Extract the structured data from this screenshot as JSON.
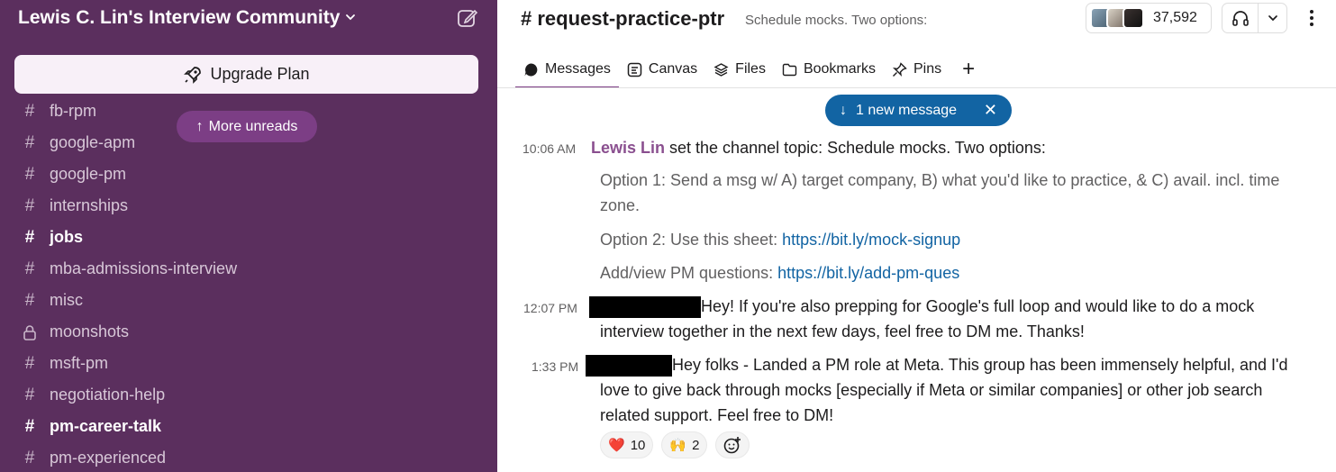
{
  "workspace": {
    "name": "Lewis C. Lin's Interview Community"
  },
  "sidebar": {
    "upgrade_label": "Upgrade Plan",
    "more_unreads_label": "More unreads",
    "channels": [
      {
        "name": "fb-rpm",
        "bold": false,
        "private": false
      },
      {
        "name": "google-apm",
        "bold": false,
        "private": false
      },
      {
        "name": "google-pm",
        "bold": false,
        "private": false
      },
      {
        "name": "internships",
        "bold": false,
        "private": false
      },
      {
        "name": "jobs",
        "bold": true,
        "private": false
      },
      {
        "name": "mba-admissions-interview",
        "bold": false,
        "private": false
      },
      {
        "name": "misc",
        "bold": false,
        "private": false
      },
      {
        "name": "moonshots",
        "bold": false,
        "private": true
      },
      {
        "name": "msft-pm",
        "bold": false,
        "private": false
      },
      {
        "name": "negotiation-help",
        "bold": false,
        "private": false
      },
      {
        "name": "pm-career-talk",
        "bold": true,
        "private": false
      },
      {
        "name": "pm-experienced",
        "bold": false,
        "private": false
      }
    ]
  },
  "channel": {
    "title": "# request-practice-ptr",
    "topic": "Schedule mocks. Two options:",
    "member_count": "37,592"
  },
  "tabs": [
    {
      "label": "Messages",
      "icon": "messages-icon"
    },
    {
      "label": "Canvas",
      "icon": "canvas-icon"
    },
    {
      "label": "Files",
      "icon": "files-icon"
    },
    {
      "label": "Bookmarks",
      "icon": "bookmarks-icon"
    },
    {
      "label": "Pins",
      "icon": "pin-icon"
    }
  ],
  "new_message_banner": "1 new message",
  "messages": {
    "m1": {
      "time": "10:06 AM",
      "author": "Lewis Lin",
      "action": " set the channel topic: Schedule mocks. Two options:",
      "line1": "Option 1: Send a msg w/ A) target company, B) what you'd like to practice, & C) avail. incl. time",
      "line2": "zone.",
      "opt2_prefix": "Option 2: Use this sheet: ",
      "opt2_link": "https://bit.ly/mock-signup",
      "opt3_prefix": "Add/view PM questions: ",
      "opt3_link": "https://bit.ly/add-pm-ques"
    },
    "m2": {
      "time": "12:07 PM",
      "line1": "Hey! If you're also prepping for Google's full loop and would like to do a mock",
      "line2": "interview together in the next few days, feel free to DM me. Thanks!"
    },
    "m3": {
      "time": "1:33 PM",
      "line1": "Hey folks - Landed a PM role at Meta. This group has been immensely helpful, and I'd",
      "line2": "love to give back through mocks [especially if Meta or similar companies] or other job search",
      "line3": "related support. Feel free to DM!",
      "reactions": [
        {
          "emoji": "❤️",
          "count": "10"
        },
        {
          "emoji": "🙌",
          "count": "2"
        }
      ]
    }
  }
}
